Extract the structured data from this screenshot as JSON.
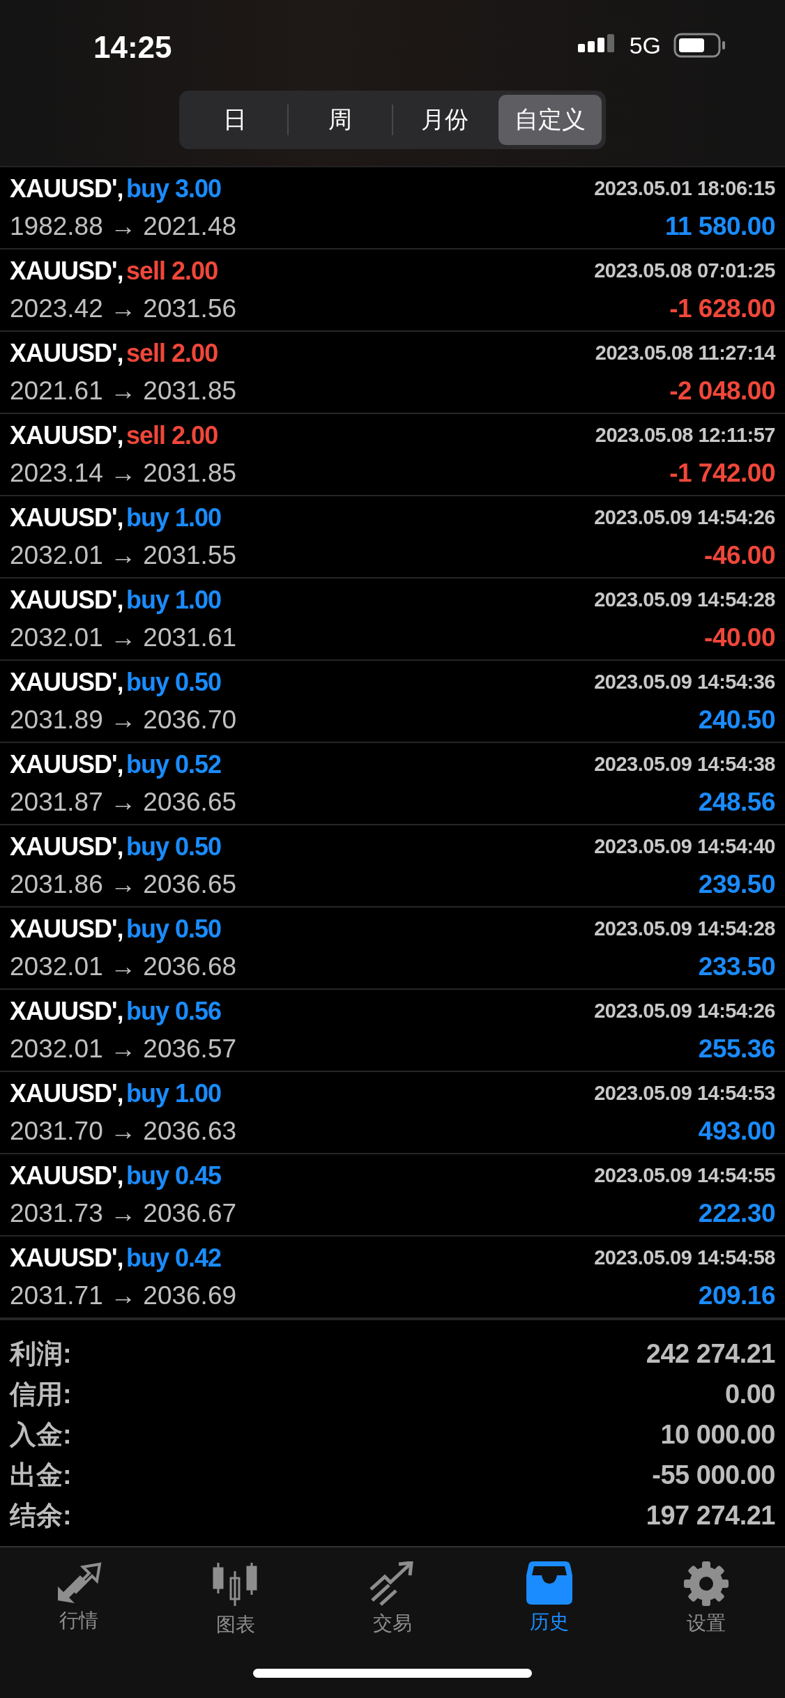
{
  "status_bar": {
    "time": "14:25",
    "network": "5G"
  },
  "period_tabs": [
    {
      "label": "日",
      "selected": false
    },
    {
      "label": "周",
      "selected": false
    },
    {
      "label": "月份",
      "selected": false
    },
    {
      "label": "自定义",
      "selected": true
    }
  ],
  "deals": [
    {
      "symbol": "XAUUSD',",
      "side": {
        "text": "buy",
        "color": "#1a8cff"
      },
      "lots": "3.00",
      "time": "2023.05.01 18:06:15",
      "prices": "1982.88 → 2021.48",
      "profit": {
        "text": "11 580.00",
        "color": "#1a8cff"
      }
    },
    {
      "symbol": "XAUUSD',",
      "side": {
        "text": "sell",
        "color": "#f0473a"
      },
      "lots": "2.00",
      "time": "2023.05.08 07:01:25",
      "prices": "2023.42 → 2031.56",
      "profit": {
        "text": "-1 628.00",
        "color": "#f0473a"
      }
    },
    {
      "symbol": "XAUUSD',",
      "side": {
        "text": "sell",
        "color": "#f0473a"
      },
      "lots": "2.00",
      "time": "2023.05.08 11:27:14",
      "prices": "2021.61 → 2031.85",
      "profit": {
        "text": "-2 048.00",
        "color": "#f0473a"
      }
    },
    {
      "symbol": "XAUUSD',",
      "side": {
        "text": "sell",
        "color": "#f0473a"
      },
      "lots": "2.00",
      "time": "2023.05.08 12:11:57",
      "prices": "2023.14 → 2031.85",
      "profit": {
        "text": "-1 742.00",
        "color": "#f0473a"
      }
    },
    {
      "symbol": "XAUUSD',",
      "side": {
        "text": "buy",
        "color": "#1a8cff"
      },
      "lots": "1.00",
      "time": "2023.05.09 14:54:26",
      "prices": "2032.01 → 2031.55",
      "profit": {
        "text": "-46.00",
        "color": "#f0473a"
      }
    },
    {
      "symbol": "XAUUSD',",
      "side": {
        "text": "buy",
        "color": "#1a8cff"
      },
      "lots": "1.00",
      "time": "2023.05.09 14:54:28",
      "prices": "2032.01 → 2031.61",
      "profit": {
        "text": "-40.00",
        "color": "#f0473a"
      }
    },
    {
      "symbol": "XAUUSD',",
      "side": {
        "text": "buy",
        "color": "#1a8cff"
      },
      "lots": "0.50",
      "time": "2023.05.09 14:54:36",
      "prices": "2031.89 → 2036.70",
      "profit": {
        "text": "240.50",
        "color": "#1a8cff"
      }
    },
    {
      "symbol": "XAUUSD',",
      "side": {
        "text": "buy",
        "color": "#1a8cff"
      },
      "lots": "0.52",
      "time": "2023.05.09 14:54:38",
      "prices": "2031.87 → 2036.65",
      "profit": {
        "text": "248.56",
        "color": "#1a8cff"
      }
    },
    {
      "symbol": "XAUUSD',",
      "side": {
        "text": "buy",
        "color": "#1a8cff"
      },
      "lots": "0.50",
      "time": "2023.05.09 14:54:40",
      "prices": "2031.86 → 2036.65",
      "profit": {
        "text": "239.50",
        "color": "#1a8cff"
      }
    },
    {
      "symbol": "XAUUSD',",
      "side": {
        "text": "buy",
        "color": "#1a8cff"
      },
      "lots": "0.50",
      "time": "2023.05.09 14:54:28",
      "prices": "2032.01 → 2036.68",
      "profit": {
        "text": "233.50",
        "color": "#1a8cff"
      }
    },
    {
      "symbol": "XAUUSD',",
      "side": {
        "text": "buy",
        "color": "#1a8cff"
      },
      "lots": "0.56",
      "time": "2023.05.09 14:54:26",
      "prices": "2032.01 → 2036.57",
      "profit": {
        "text": "255.36",
        "color": "#1a8cff"
      }
    },
    {
      "symbol": "XAUUSD',",
      "side": {
        "text": "buy",
        "color": "#1a8cff"
      },
      "lots": "1.00",
      "time": "2023.05.09 14:54:53",
      "prices": "2031.70 → 2036.63",
      "profit": {
        "text": "493.00",
        "color": "#1a8cff"
      }
    },
    {
      "symbol": "XAUUSD',",
      "side": {
        "text": "buy",
        "color": "#1a8cff"
      },
      "lots": "0.45",
      "time": "2023.05.09 14:54:55",
      "prices": "2031.73 → 2036.67",
      "profit": {
        "text": "222.30",
        "color": "#1a8cff"
      }
    },
    {
      "symbol": "XAUUSD',",
      "side": {
        "text": "buy",
        "color": "#1a8cff"
      },
      "lots": "0.42",
      "time": "2023.05.09 14:54:58",
      "prices": "2031.71 → 2036.69",
      "profit": {
        "text": "209.16",
        "color": "#1a8cff"
      }
    }
  ],
  "summary": [
    {
      "label": "利润:",
      "value": "242 274.21"
    },
    {
      "label": "信用:",
      "value": "0.00"
    },
    {
      "label": "入金:",
      "value": "10 000.00"
    },
    {
      "label": "出金:",
      "value": "-55 000.00"
    },
    {
      "label": "结余:",
      "value": "197 274.21"
    }
  ],
  "tab_bar": [
    {
      "kind": "quotes",
      "label": "行情",
      "selected": false
    },
    {
      "kind": "chart",
      "label": "图表",
      "selected": false
    },
    {
      "kind": "trade",
      "label": "交易",
      "selected": false
    },
    {
      "kind": "history",
      "label": "历史",
      "selected": true
    },
    {
      "kind": "settings",
      "label": "设置",
      "selected": false
    }
  ]
}
